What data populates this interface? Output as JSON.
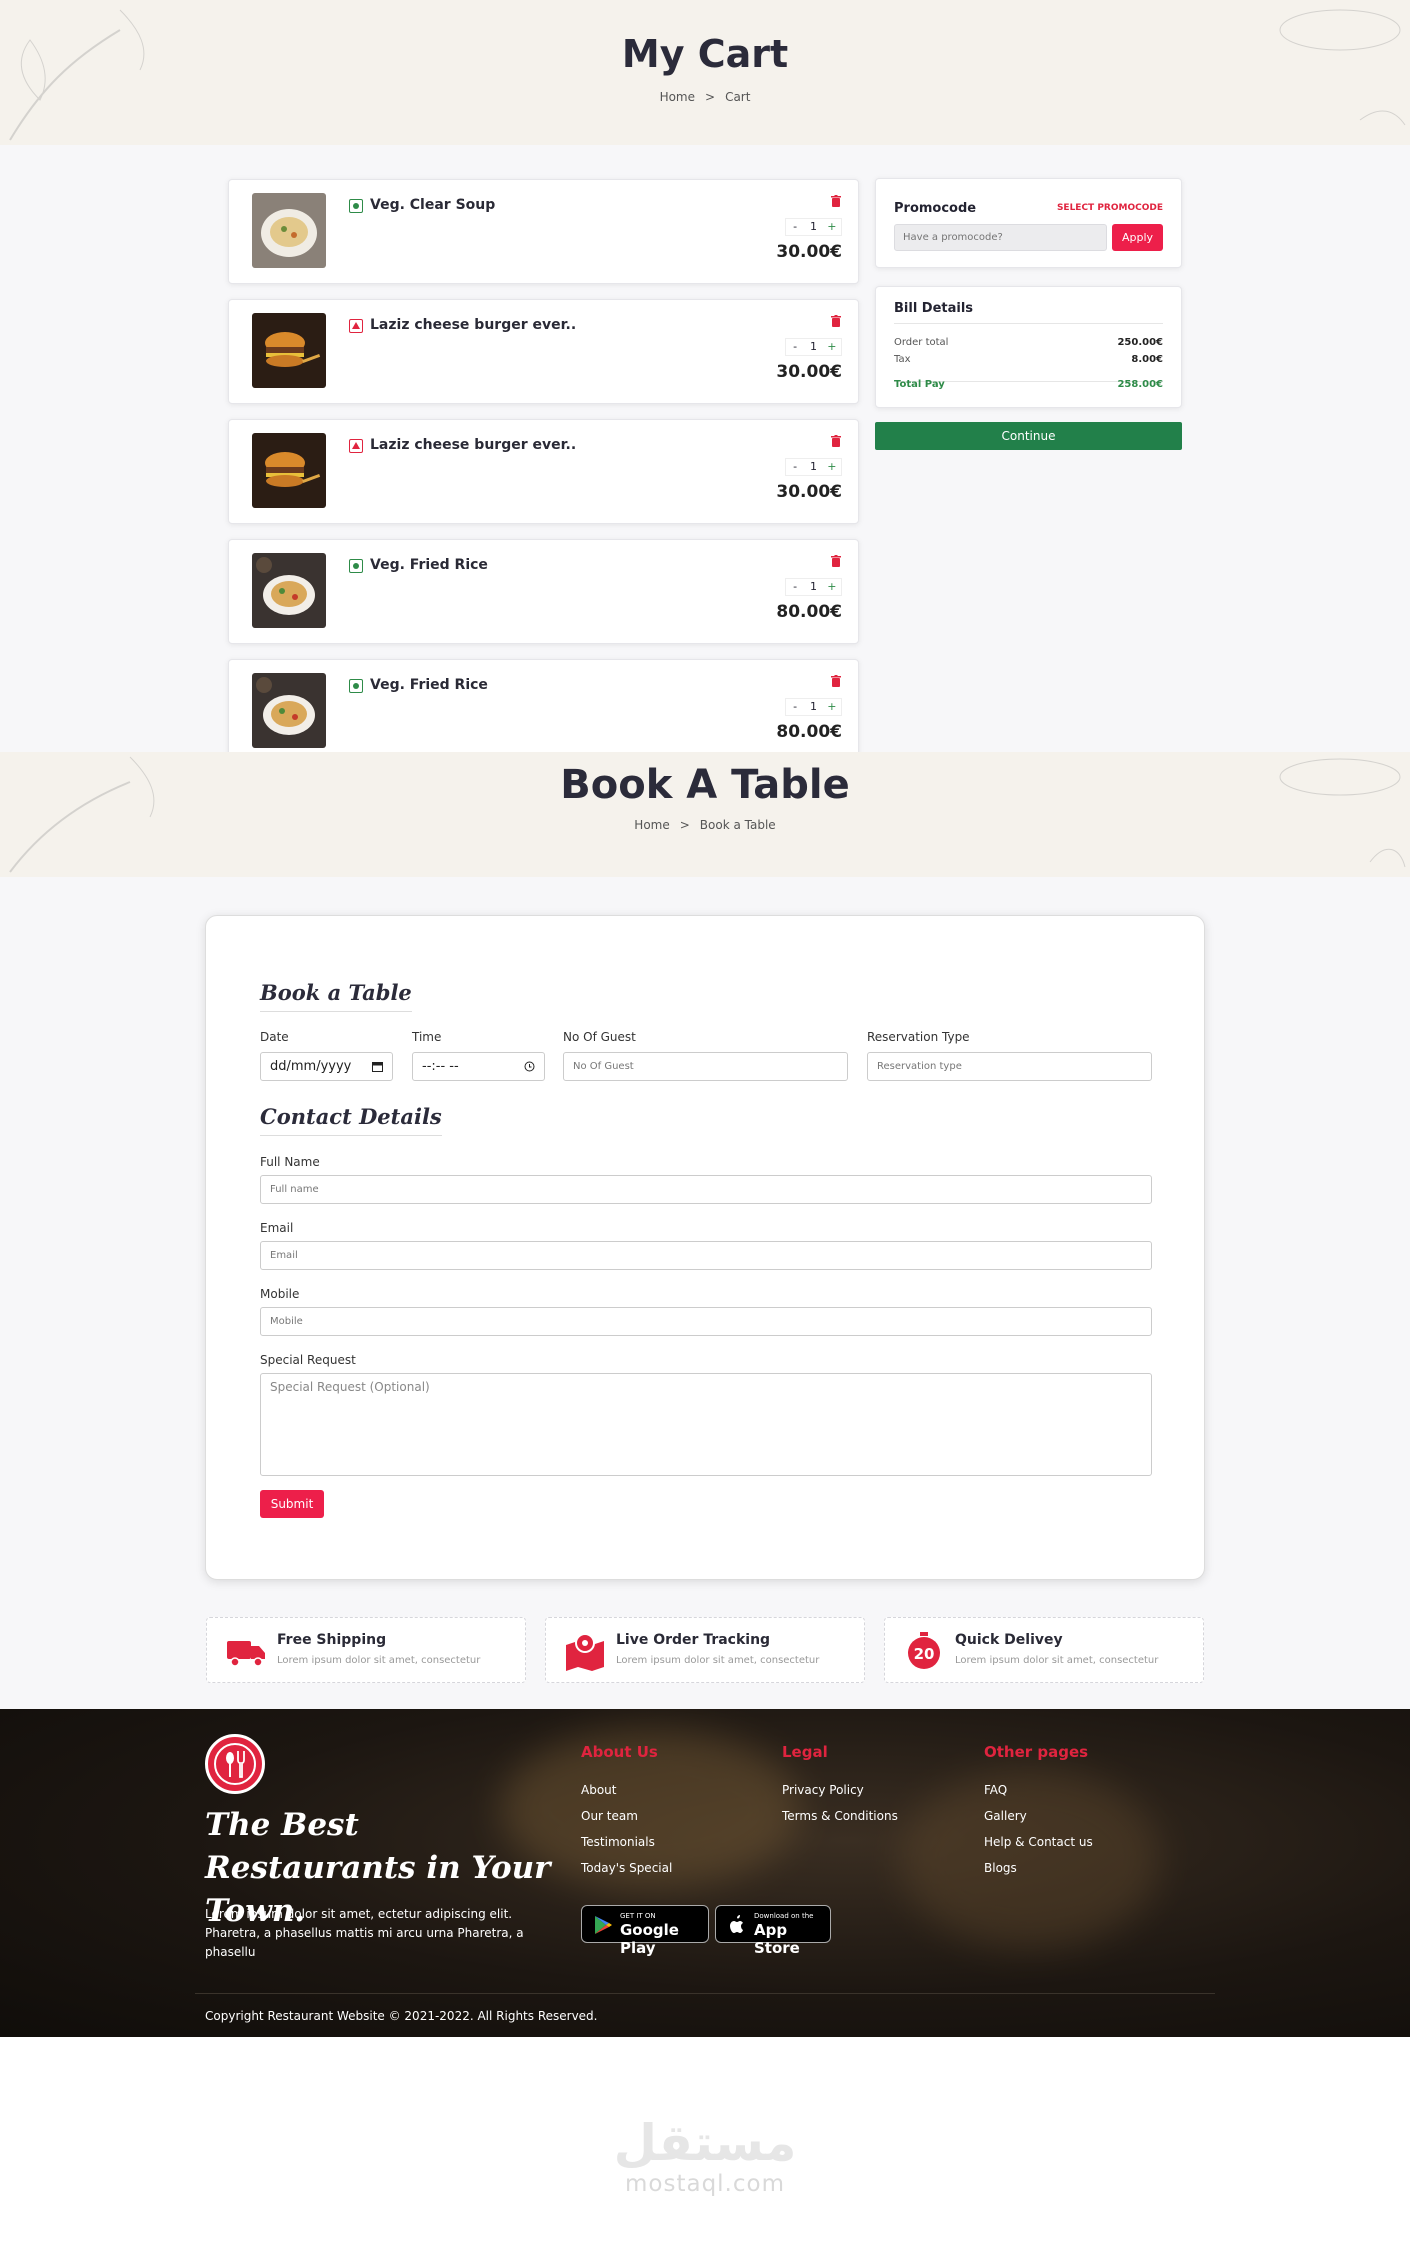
{
  "cart": {
    "title": "My Cart",
    "breadcrumb": [
      "Home",
      ">",
      "Cart"
    ],
    "items": [
      {
        "name": "Veg. Clear Soup",
        "veg": true,
        "qty": "1",
        "price": "30.00€"
      },
      {
        "name": "Laziz cheese burger ever..",
        "veg": false,
        "qty": "1",
        "price": "30.00€"
      },
      {
        "name": "Laziz cheese burger ever..",
        "veg": false,
        "qty": "1",
        "price": "30.00€"
      },
      {
        "name": "Veg. Fried Rice",
        "veg": true,
        "qty": "1",
        "price": "80.00€"
      },
      {
        "name": "Veg. Fried Rice",
        "veg": true,
        "qty": "1",
        "price": "80.00€"
      }
    ],
    "qty_minus": "-",
    "qty_plus": "+",
    "promo": {
      "label": "Promocode",
      "select": "SELECT PROMOCODE",
      "placeholder": "Have a promocode?",
      "apply": "Apply"
    },
    "bill": {
      "title": "Bill Details",
      "order_total_label": "Order total",
      "order_total": "250.00€",
      "tax_label": "Tax",
      "tax": "8.00€",
      "total_label": "Total Pay",
      "total": "258.00€"
    },
    "continue": "Continue"
  },
  "book": {
    "title": "Book A Table",
    "breadcrumb": [
      "Home",
      ">",
      "Book a Table"
    ],
    "form_title": "Book a Table",
    "date_label": "Date",
    "date_value": "dd/mm/yyyy",
    "time_label": "Time",
    "time_value": "--:-- --",
    "guest_label": "No Of Guest",
    "guest_placeholder": "No Of Guest",
    "res_label": "Reservation Type",
    "res_placeholder": "Reservation type",
    "contact_title": "Contact Details",
    "fullname_label": "Full Name",
    "fullname_placeholder": "Full name",
    "email_label": "Email",
    "email_placeholder": "Email",
    "mobile_label": "Mobile",
    "mobile_placeholder": "Mobile",
    "special_label": "Special Request",
    "special_placeholder": "Special Request (Optional)",
    "submit": "Submit"
  },
  "features": [
    {
      "title": "Free Shipping",
      "desc": "Lorem ipsum dolor sit amet, consectetur",
      "icon": "truck-icon"
    },
    {
      "title": "Live Order Tracking",
      "desc": "Lorem ipsum dolor sit amet, consectetur",
      "icon": "map-pin-icon"
    },
    {
      "title": "Quick Delivey",
      "desc": "Lorem ipsum dolor sit amet, consectetur",
      "icon": "timer-icon",
      "badge": "20"
    }
  ],
  "footer": {
    "tagline": "The Best Restaurants in Your Town.",
    "text": "Lorem ipsum dolor sit amet, ectetur adipiscing elit. Pharetra, a phasellus mattis mi arcu urna Pharetra, a phasellu",
    "about": {
      "title": "About Us",
      "links": [
        "About",
        "Our team",
        "Testimonials",
        "Today's Special"
      ]
    },
    "legal": {
      "title": "Legal",
      "links": [
        "Privacy Policy",
        "Terms & Conditions"
      ]
    },
    "other": {
      "title": "Other pages",
      "links": [
        "FAQ",
        "Gallery",
        "Help & Contact us",
        "Blogs"
      ]
    },
    "google": {
      "small": "GET IT ON",
      "big": "Google Play"
    },
    "apple": {
      "small": "Download on the",
      "big": "App Store"
    },
    "copyright": "Copyright Restaurant Website © 2021-2022. All Rights Reserved."
  },
  "watermark": {
    "arabic": "مستقل",
    "latin": "mostaql.com"
  },
  "colors": {
    "accent": "#ed1f4a",
    "green": "#22804a",
    "veg": "#2e8b48",
    "nonveg": "#e0243f"
  }
}
